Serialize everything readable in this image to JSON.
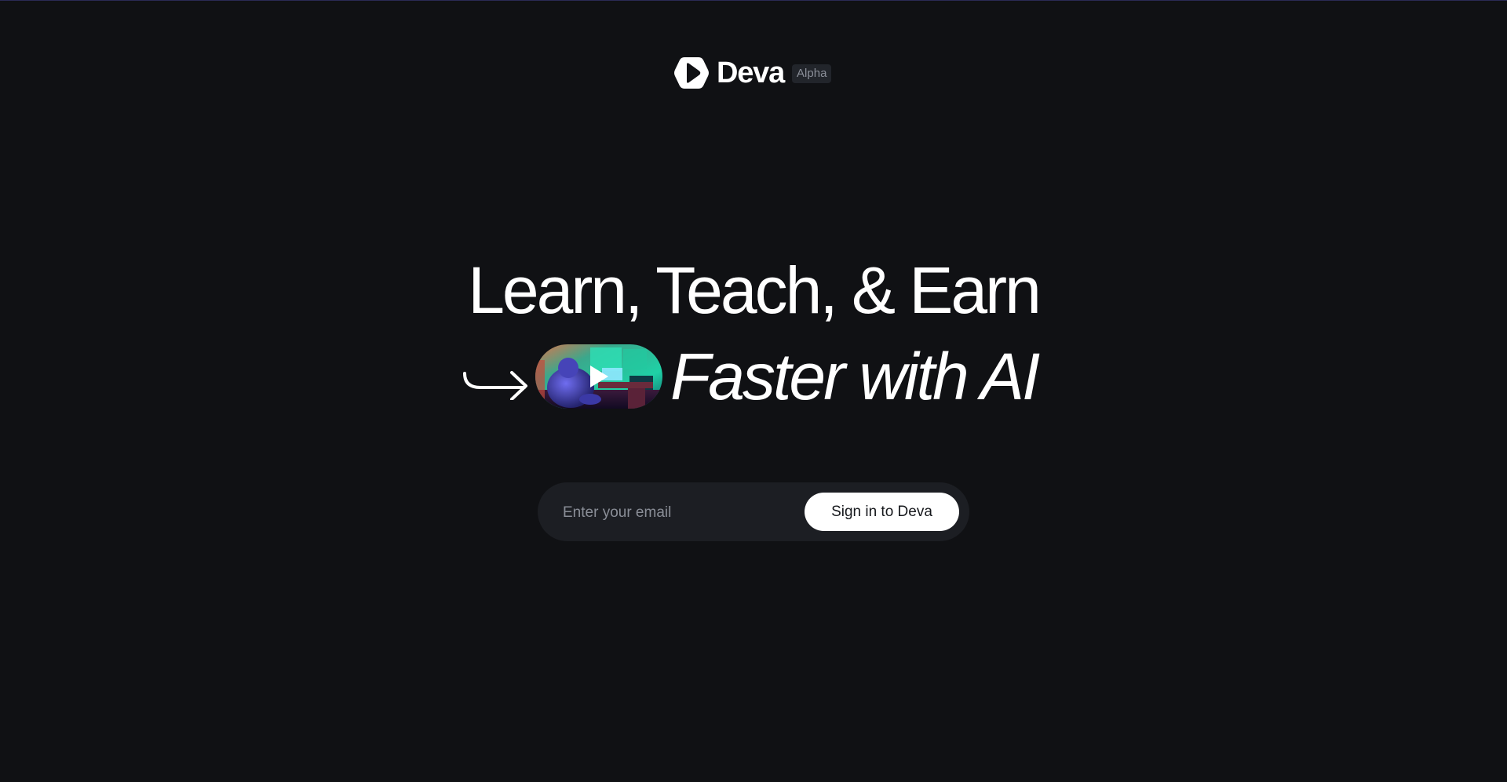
{
  "brand": {
    "name": "Deva",
    "badge": "Alpha",
    "logo_icon": "deva-logo-icon"
  },
  "hero": {
    "line1": "Learn, Teach, & Earn",
    "line2": "Faster with AI",
    "arrow_icon": "curved-arrow-right-icon",
    "video_thumbnail": "video-thumbnail",
    "play_icon": "play-icon"
  },
  "signin": {
    "email_placeholder": "Enter your email",
    "email_value": "",
    "button_label": "Sign in to Deva"
  },
  "colors": {
    "background": "#101114",
    "text": "#ffffff",
    "input_bg": "#1c1e23",
    "button_bg": "#ffffff",
    "button_text": "#16181c",
    "badge_bg": "#22252b",
    "badge_text": "#8b8f99",
    "placeholder": "#8a8e97"
  }
}
